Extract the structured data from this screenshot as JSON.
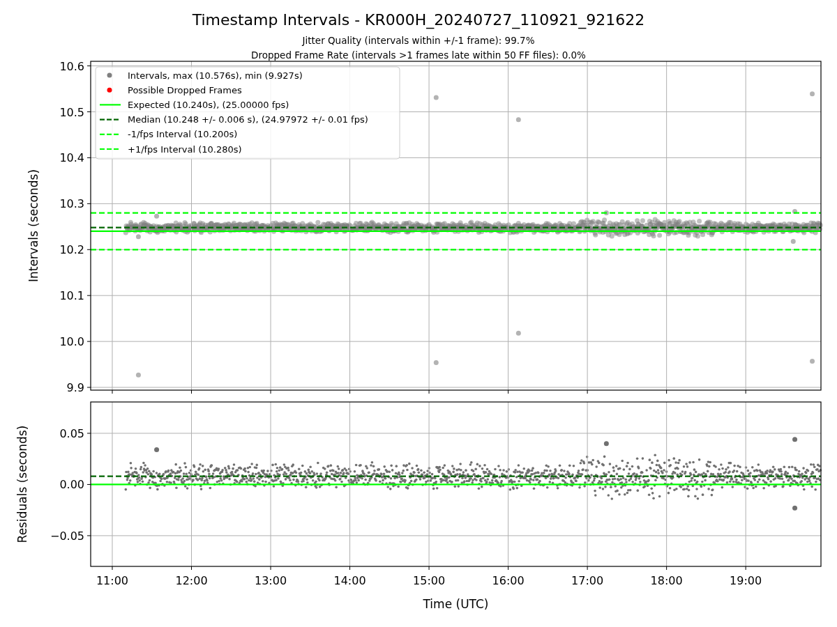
{
  "figure": {
    "title": "Timestamp Intervals - KR000H_20240727_110921_921622",
    "subtitles": [
      "Jitter Quality (intervals within +/-1 frame): 99.7%",
      "Dropped Frame Rate (intervals >1 frames late within 50 FF files): 0.0%"
    ]
  },
  "panels": [
    {
      "kind": "intervals",
      "chart_data": {
        "type": "scatter",
        "legend": "upper left",
        "ylabel": "Intervals (seconds)",
        "xlim": [
          10.727,
          19.95
        ],
        "ylim": [
          9.894,
          10.61
        ],
        "grid": true,
        "yticks": [
          {
            "value": 9.9,
            "label": "9.9"
          },
          {
            "value": 10.0,
            "label": "10.0"
          },
          {
            "value": 10.1,
            "label": "10.1"
          },
          {
            "value": 10.2,
            "label": "10.2"
          },
          {
            "value": 10.3,
            "label": "10.3"
          },
          {
            "value": 10.4,
            "label": "10.4"
          },
          {
            "value": 10.5,
            "label": "10.5"
          },
          {
            "value": 10.6,
            "label": "10.6"
          }
        ],
        "x": [
          11.33,
          15.09,
          15.09,
          16.13,
          16.13,
          19.84,
          19.84
        ],
        "series": [
          {
            "name": "Intervals, max (10.576s), min (9.927s)",
            "color": "#808080",
            "values": [
              9.927,
              10.531,
              9.954,
              10.483,
              10.018,
              10.539,
              9.957
            ]
          },
          {
            "name": "Possible Dropped Frames",
            "color": "#ff0000",
            "values": [
              null,
              null,
              null,
              null,
              null,
              null,
              null
            ]
          }
        ],
        "ref_lines": [
          {
            "axis": "y",
            "value": 10.24,
            "color": "#00ff00",
            "label": "Expected (10.240s), (25.00000 fps)"
          },
          {
            "axis": "y",
            "value": 10.248,
            "color": "#006400",
            "label": "Median (10.248 +/- 0.006 s), (24.97972 +/- 0.01 fps)"
          },
          {
            "axis": "y",
            "value": 10.2,
            "color": "#00ff00",
            "label": "-1/fps Interval (10.200s)"
          },
          {
            "axis": "y",
            "value": 10.28,
            "color": "#00ff00",
            "label": "+1/fps Interval (10.280s)"
          }
        ]
      }
    },
    {
      "kind": "residuals",
      "chart_data": {
        "type": "scatter",
        "xlabel": "Time (UTC)",
        "ylabel": "Residuals (seconds)",
        "xlim": [
          10.727,
          19.95
        ],
        "ylim": [
          -0.08,
          0.0806
        ],
        "grid": true,
        "xticks": [
          {
            "value": 11,
            "label": "11:00"
          },
          {
            "value": 12,
            "label": "12:00"
          },
          {
            "value": 13,
            "label": "13:00"
          },
          {
            "value": 14,
            "label": "14:00"
          },
          {
            "value": 15,
            "label": "15:00"
          },
          {
            "value": 16,
            "label": "16:00"
          },
          {
            "value": 17,
            "label": "17:00"
          },
          {
            "value": 18,
            "label": "18:00"
          },
          {
            "value": 19,
            "label": "19:00"
          }
        ],
        "yticks": [
          {
            "value": -0.05,
            "label": "−0.05"
          },
          {
            "value": 0,
            "label": "0.00"
          },
          {
            "value": 0.05,
            "label": "0.05"
          }
        ],
        "x": [
          11.56,
          17.24,
          19.62,
          19.62
        ],
        "series": [
          {
            "color": "#707070",
            "values": [
              0.034,
              0.04,
              0.044,
              -0.023
            ]
          }
        ],
        "ref_lines": [
          {
            "axis": "y",
            "value": 0,
            "color": "#00ff00"
          },
          {
            "axis": "y",
            "value": 0.008,
            "color": "#006400"
          }
        ]
      }
    }
  ]
}
